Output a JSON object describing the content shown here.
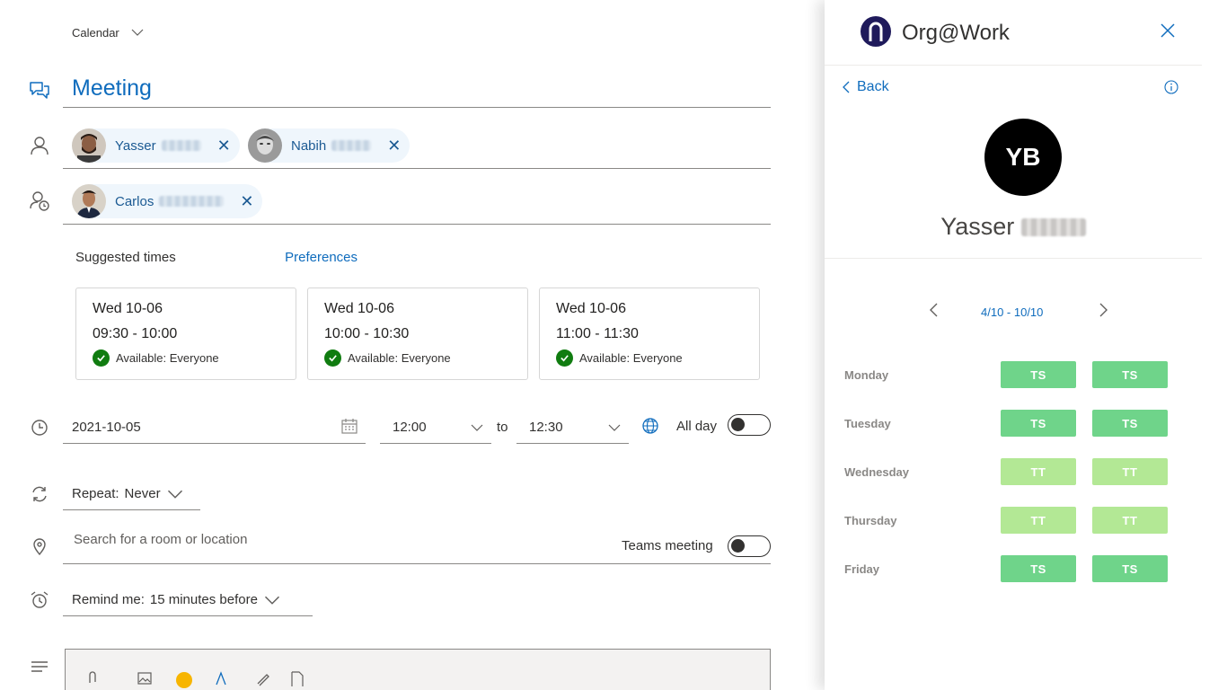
{
  "composer": {
    "calendar_picker": "Calendar",
    "title": "Meeting",
    "required_attendees": [
      {
        "first": "Yasser"
      },
      {
        "first": "Nabih"
      }
    ],
    "optional_attendees": [
      {
        "first": "Carlos"
      }
    ],
    "suggested_times_label": "Suggested times",
    "preferences_link": "Preferences",
    "suggestions": [
      {
        "date": "Wed 10-06",
        "time": "09:30 - 10:00",
        "availability": "Available: Everyone"
      },
      {
        "date": "Wed 10-06",
        "time": "10:00 - 10:30",
        "availability": "Available: Everyone"
      },
      {
        "date": "Wed 10-06",
        "time": "11:00 - 11:30",
        "availability": "Available: Everyone"
      }
    ],
    "date_value": "2021-10-05",
    "start_time": "12:00",
    "to_label": "to",
    "end_time": "12:30",
    "all_day_label": "All day",
    "all_day_on": false,
    "repeat_label": "Repeat:",
    "repeat_value": "Never",
    "location_placeholder": "Search for a room or location",
    "teams_meeting_label": "Teams meeting",
    "teams_meeting_on": false,
    "remind_label": "Remind me:",
    "remind_value": "15 minutes before"
  },
  "panel": {
    "app_title": "Org@Work",
    "back_label": "Back",
    "avatar_initials": "YB",
    "person_name": "Yasser",
    "date_range": "4/10 - 10/10",
    "schedule": [
      {
        "day": "Monday",
        "slots": [
          "TS",
          "TS"
        ]
      },
      {
        "day": "Tuesday",
        "slots": [
          "TS",
          "TS"
        ]
      },
      {
        "day": "Wednesday",
        "slots": [
          "TT",
          "TT"
        ]
      },
      {
        "day": "Thursday",
        "slots": [
          "TT",
          "TT"
        ]
      },
      {
        "day": "Friday",
        "slots": [
          "TS",
          "TS"
        ]
      }
    ],
    "colors": {
      "TS": "#6fd48a",
      "TT": "#b3e895"
    }
  },
  "colors": {
    "accent": "#0f6cbd",
    "available": "#107c10"
  }
}
